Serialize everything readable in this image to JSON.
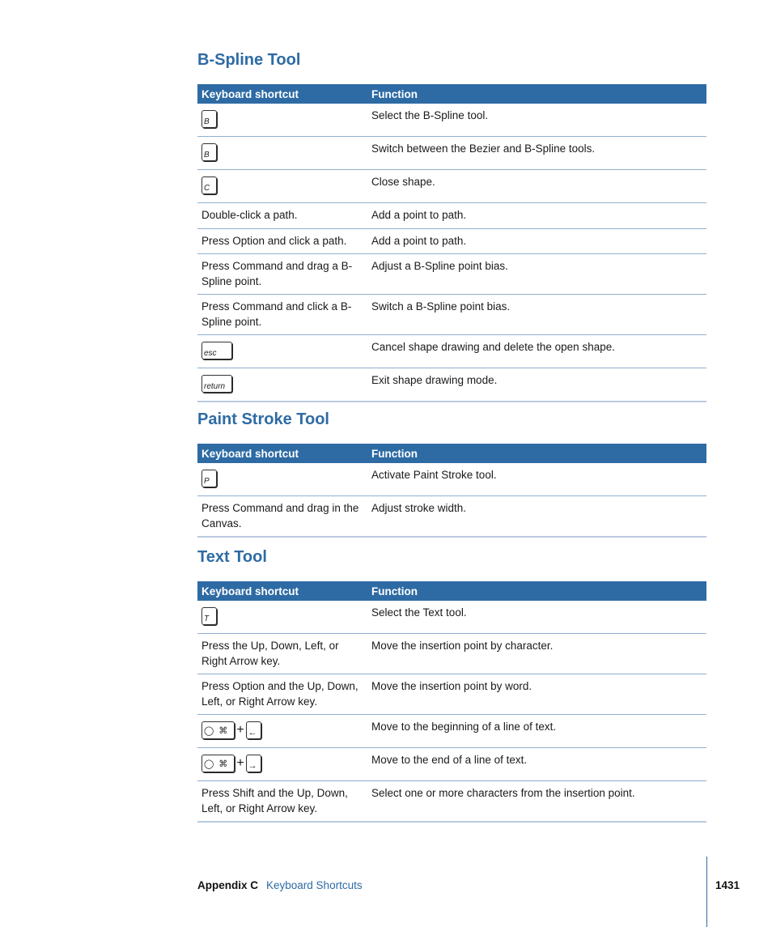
{
  "sections": [
    {
      "title": "B-Spline Tool",
      "headers": [
        "Keyboard shortcut",
        "Function"
      ],
      "rows": [
        {
          "key": "B",
          "function": "Select the B-Spline tool."
        },
        {
          "key": "B",
          "function": "Switch between the Bezier and B-Spline tools."
        },
        {
          "key": "C",
          "function": "Close shape."
        },
        {
          "shortcut": "Double-click a path.",
          "function": "Add a point to path."
        },
        {
          "shortcut": "Press Option and click a path.",
          "function": "Add a point to path."
        },
        {
          "shortcut": "Press Command and drag a B-Spline point.",
          "function": "Adjust a B-Spline point bias."
        },
        {
          "shortcut": "Press Command and click a B-Spline point.",
          "function": "Switch a B-Spline point bias."
        },
        {
          "key": "esc",
          "function": "Cancel shape drawing and delete the open shape."
        },
        {
          "key": "return",
          "function": "Exit shape drawing mode."
        }
      ]
    },
    {
      "title": "Paint Stroke Tool",
      "headers": [
        "Keyboard shortcut",
        "Function"
      ],
      "rows": [
        {
          "key": "P",
          "function": "Activate Paint Stroke tool."
        },
        {
          "shortcut": "Press Command and drag in the Canvas.",
          "function": "Adjust stroke width."
        }
      ]
    },
    {
      "title": "Text Tool",
      "headers": [
        "Keyboard shortcut",
        "Function"
      ],
      "rows": [
        {
          "key": "T",
          "function": "Select the Text tool."
        },
        {
          "shortcut": "Press the Up, Down, Left, or Right Arrow key.",
          "function": "Move the insertion point by character."
        },
        {
          "shortcut": "Press Option and the Up, Down, Left, or Right Arrow key.",
          "function": "Move the insertion point by word."
        },
        {
          "combo": "⌘",
          "plus": "+",
          "arrow": "←",
          "function": "Move to the beginning of a line of text."
        },
        {
          "combo": "⌘",
          "plus": "+",
          "arrow": "→",
          "function": "Move to the end of a line of text."
        },
        {
          "shortcut": "Press Shift and the Up, Down, Left, or Right Arrow key.",
          "function": "Select one or more characters from the insertion point."
        }
      ]
    }
  ],
  "footer": {
    "appendix": "Appendix C",
    "chapter": "Keyboard Shortcuts",
    "page_number": "1431"
  }
}
